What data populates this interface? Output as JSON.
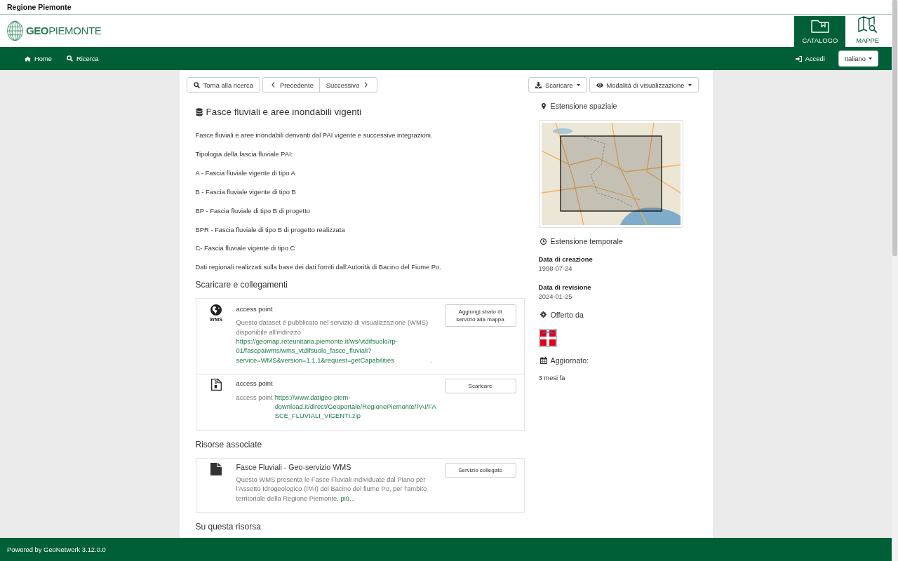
{
  "top_bar": {
    "title": "Regione Piemonte"
  },
  "header": {
    "logo_text": "**GEO**PIEMONTE",
    "apps": [
      {
        "kind": "catalog",
        "label": "CATALOGO",
        "selected": true
      },
      {
        "kind": "maps",
        "label": "MAPPE",
        "selected": false
      }
    ]
  },
  "nav": {
    "links": [
      {
        "kind": "home",
        "label": "Home"
      },
      {
        "kind": "search",
        "label": "Ricerca"
      }
    ],
    "login": "Accedi",
    "language": "Italiano"
  },
  "toolbar": {
    "back": "Torna alla ricerca",
    "previous": "Precedente",
    "next": "Successivo",
    "download": "Scaricare",
    "view_mode": "Modalità di visualizzazione"
  },
  "record": {
    "title": "Fasce fluviali e aree inondabili vigenti",
    "description": [
      "Fasce fluviali e aree inondabili derivanti dal PAI vigente e successive integrazioni.",
      "Tipologia della fascia fluviale PAI:",
      "A - Fascia fluviale vigente di tipo A",
      "B - Fascia fluviale vigente di tipo B",
      "BP - Fascia fluviale di tipo B di progetto",
      "BPR - Fascia fluviale di tipo B di progetto realizzata",
      "C- Fascia fluviale vigente di tipo C",
      "Dati regionali realizzati sulla base dei dati forniti dall'Autorità di Bacino del Fiume Po."
    ]
  },
  "links_section": {
    "heading": "Scaricare e collegamenti",
    "items": [
      {
        "kind": "wms",
        "icon_label": "WMS",
        "title": "access point",
        "text": "Questo dataset è pubblicato nel servizio di visualizzazione (WMS) disponibile all'indirizzo",
        "url": "https://geomap.reteunitaria.piemonte.it/ws/vtdifsuolo/rp-01/fascpaiwms/wms_vtdifsuolo_fasce_fluviali?service=WMS&version=1.1.1&request=getCapabilities",
        "after": ".",
        "button": "Aggiungi strato di servizio alla mappa"
      },
      {
        "kind": "file",
        "title": "access point",
        "text": "access point",
        "url": "https://www.datigeo-piem-download.it/direct/Geoportale/RegionePiemonte/PAI/FASCE_FLUVIALI_VIGENTI.zip",
        "button": "Scaricare"
      }
    ]
  },
  "related_section": {
    "heading": "Risorse associate",
    "items": [
      {
        "title": "Fasce Fluviali - Geo-servizio WMS",
        "text": "Questo WMS presenta le Fasce Fluviali individuate dal Piano per l'Assetto Idrogeologico (PAI) del Bacino del fiume Po, per l'ambito territoriale della Regione Piemonte.",
        "more": "più...",
        "button": "Servizio collegato"
      }
    ]
  },
  "about_section": {
    "heading": "Su questa risorsa"
  },
  "sidebar": {
    "spatial_heading": "Estensione spaziale",
    "temporal_heading": "Estensione temporale",
    "dates": [
      {
        "label": "Data di creazione",
        "value": "1998-07-24"
      },
      {
        "label": "Data di revisione",
        "value": "2024-01-25"
      }
    ],
    "provider_heading": "Offerto da",
    "updated_heading": "Aggiornato:",
    "updated_value": "3 mesi fa"
  },
  "footer": {
    "text": "Powered by GeoNetwork 3.12.0.0"
  }
}
